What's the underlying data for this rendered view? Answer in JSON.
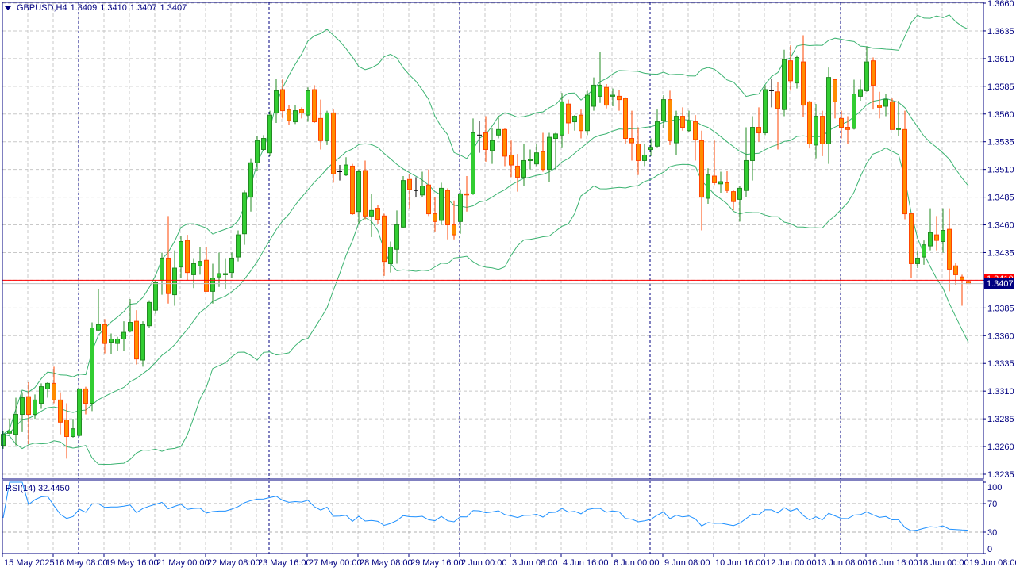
{
  "header": {
    "symbol": "GBPUSD,H4",
    "open": "1.3409",
    "high": "1.3410",
    "low": "1.3407",
    "close": "1.3407",
    "dropdown_icon": "triangle-down-icon"
  },
  "rsi_panel": {
    "label": "RSI(14)",
    "value": "32.4450",
    "levels_labels": [
      "100",
      "70",
      "30",
      "0"
    ]
  },
  "price_labels": {
    "bid": "1.3407",
    "ask": "1.3410"
  },
  "colors": {
    "frame": "#000080",
    "bull_fill": "#32cd32",
    "bull_border": "#228b22",
    "bear_fill": "#ff8c00",
    "bear_border": "#ff4500",
    "doji": "#000000",
    "bands": "#3cb371",
    "rsi": "#1e90ff",
    "ask_line": "#ff0000",
    "bid_line": "#c0c0c0",
    "grid": "#c8c8c8"
  },
  "chart_data": {
    "type": "candlestick",
    "title": "GBPUSD,H4",
    "y_axis": {
      "min": 1.3235,
      "max": 1.366,
      "step": 0.0025,
      "tick_labels": [
        "1.3660",
        "1.3635",
        "1.3610",
        "1.3585",
        "1.3560",
        "1.3535",
        "1.3510",
        "1.3485",
        "1.3460",
        "1.3435",
        "1.3410",
        "1.3385",
        "1.3360",
        "1.3335",
        "1.3310",
        "1.3285",
        "1.3260",
        "1.3235"
      ]
    },
    "x_axis": {
      "tick_every_candles": 8,
      "tick_labels": [
        "15 May 2025",
        "16 May 08:00",
        "19 May 16:00",
        "21 May 00:00",
        "22 May 08:00",
        "23 May 16:00",
        "27 May 00:00",
        "28 May 08:00",
        "29 May 16:00",
        "2 Jun 00:00",
        "3 Jun 08:00",
        "4 Jun 16:00",
        "6 Jun 00:00",
        "9 Jun 08:00",
        "10 Jun 16:00",
        "12 Jun 00:00",
        "13 Jun 08:00",
        "16 Jun 16:00",
        "18 Jun 00:00",
        "19 Jun 08:00"
      ]
    },
    "period_separators_at_candle": [
      12,
      42,
      72,
      102,
      132
    ],
    "bid": 1.3407,
    "ask": 1.341,
    "grid": true,
    "indicators": [
      {
        "name": "Bollinger Bands",
        "period": 20,
        "deviation": 2
      },
      {
        "name": "RSI",
        "period": 14,
        "levels": [
          30,
          70
        ],
        "range": [
          0,
          100
        ]
      }
    ],
    "ohlc": [
      [
        1.3261,
        1.3274,
        1.3258,
        1.3271
      ],
      [
        1.3272,
        1.3285,
        1.3271,
        1.3274
      ],
      [
        1.3271,
        1.3304,
        1.3261,
        1.3289
      ],
      [
        1.3289,
        1.3309,
        1.3273,
        1.3304
      ],
      [
        1.3305,
        1.3318,
        1.3262,
        1.3289
      ],
      [
        1.3289,
        1.3307,
        1.3285,
        1.3302
      ],
      [
        1.3299,
        1.3317,
        1.3294,
        1.3314
      ],
      [
        1.3312,
        1.3318,
        1.3304,
        1.3317
      ],
      [
        1.3317,
        1.3332,
        1.3299,
        1.3302
      ],
      [
        1.3302,
        1.3309,
        1.3271,
        1.3282
      ],
      [
        1.3284,
        1.3299,
        1.3249,
        1.3269
      ],
      [
        1.3269,
        1.3285,
        1.3268,
        1.3276
      ],
      [
        1.327,
        1.3312,
        1.3269,
        1.3312
      ],
      [
        1.3312,
        1.3314,
        1.3289,
        1.3299
      ],
      [
        1.3299,
        1.3372,
        1.3292,
        1.3367
      ],
      [
        1.3365,
        1.3402,
        1.3364,
        1.337
      ],
      [
        1.337,
        1.3375,
        1.3344,
        1.3353
      ],
      [
        1.3354,
        1.3362,
        1.3343,
        1.3357
      ],
      [
        1.3353,
        1.3359,
        1.3346,
        1.3357
      ],
      [
        1.3357,
        1.3373,
        1.3346,
        1.3363
      ],
      [
        1.3364,
        1.3393,
        1.3363,
        1.3372
      ],
      [
        1.3373,
        1.3383,
        1.3334,
        1.3339
      ],
      [
        1.3338,
        1.3373,
        1.3332,
        1.337
      ],
      [
        1.3369,
        1.3392,
        1.3367,
        1.339
      ],
      [
        1.3383,
        1.341,
        1.338,
        1.3408
      ],
      [
        1.341,
        1.3435,
        1.3397,
        1.343
      ],
      [
        1.343,
        1.3468,
        1.3389,
        1.3398
      ],
      [
        1.3397,
        1.3437,
        1.3387,
        1.3421
      ],
      [
        1.3422,
        1.345,
        1.3412,
        1.3445
      ],
      [
        1.3446,
        1.3451,
        1.341,
        1.3417
      ],
      [
        1.3415,
        1.343,
        1.3403,
        1.3425
      ],
      [
        1.3423,
        1.344,
        1.3415,
        1.3427
      ],
      [
        1.3428,
        1.344,
        1.34,
        1.34
      ],
      [
        1.34,
        1.3425,
        1.3389,
        1.3412
      ],
      [
        1.3413,
        1.3435,
        1.3404,
        1.3416
      ],
      [
        1.3415,
        1.343,
        1.3402,
        1.3416
      ],
      [
        1.3417,
        1.3435,
        1.3412,
        1.343
      ],
      [
        1.3431,
        1.3455,
        1.3427,
        1.3451
      ],
      [
        1.3452,
        1.3491,
        1.3442,
        1.3489
      ],
      [
        1.3485,
        1.352,
        1.3472,
        1.3516
      ],
      [
        1.3516,
        1.354,
        1.3509,
        1.3536
      ],
      [
        1.3528,
        1.3541,
        1.3527,
        1.3538
      ],
      [
        1.3525,
        1.3563,
        1.3522,
        1.3559
      ],
      [
        1.3561,
        1.3592,
        1.3552,
        1.3581
      ],
      [
        1.3582,
        1.3592,
        1.3556,
        1.3563
      ],
      [
        1.3564,
        1.3568,
        1.355,
        1.3554
      ],
      [
        1.3553,
        1.3568,
        1.3551,
        1.3563
      ],
      [
        1.3564,
        1.3566,
        1.3556,
        1.3561
      ],
      [
        1.3559,
        1.3584,
        1.3553,
        1.3581
      ],
      [
        1.3582,
        1.3586,
        1.3552,
        1.3553
      ],
      [
        1.3556,
        1.3573,
        1.3528,
        1.3536
      ],
      [
        1.3536,
        1.3563,
        1.3532,
        1.3561
      ],
      [
        1.3561,
        1.3564,
        1.3498,
        1.3506
      ],
      [
        1.3508,
        1.3514,
        1.35,
        1.3508
      ],
      [
        1.3505,
        1.3521,
        1.3504,
        1.3514
      ],
      [
        1.3513,
        1.3515,
        1.3469,
        1.347
      ],
      [
        1.3472,
        1.351,
        1.3461,
        1.3508
      ],
      [
        1.3509,
        1.3518,
        1.3465,
        1.3468
      ],
      [
        1.3468,
        1.3488,
        1.3449,
        1.3473
      ],
      [
        1.3475,
        1.3478,
        1.3461,
        1.3465
      ],
      [
        1.3468,
        1.347,
        1.3414,
        1.3427
      ],
      [
        1.3425,
        1.3445,
        1.3417,
        1.344
      ],
      [
        1.3438,
        1.3473,
        1.3425,
        1.346
      ],
      [
        1.3458,
        1.3504,
        1.3457,
        1.35
      ],
      [
        1.3501,
        1.3506,
        1.3475,
        1.3492
      ],
      [
        1.3491,
        1.3503,
        1.3485,
        1.3491
      ],
      [
        1.3487,
        1.3508,
        1.3485,
        1.3495
      ],
      [
        1.3496,
        1.351,
        1.3468,
        1.347
      ],
      [
        1.347,
        1.3485,
        1.3454,
        1.3463
      ],
      [
        1.3464,
        1.3498,
        1.346,
        1.3493
      ],
      [
        1.3491,
        1.3493,
        1.3447,
        1.346
      ],
      [
        1.346,
        1.3482,
        1.3447,
        1.3451
      ],
      [
        1.3463,
        1.3492,
        1.3452,
        1.3488
      ],
      [
        1.3488,
        1.3504,
        1.3472,
        1.3487
      ],
      [
        1.3488,
        1.3556,
        1.3487,
        1.3543
      ],
      [
        1.3541,
        1.3554,
        1.3525,
        1.3541
      ],
      [
        1.3543,
        1.3558,
        1.3517,
        1.3528
      ],
      [
        1.3527,
        1.3547,
        1.3515,
        1.3536
      ],
      [
        1.3541,
        1.3558,
        1.3538,
        1.3546
      ],
      [
        1.3546,
        1.3547,
        1.3513,
        1.3522
      ],
      [
        1.3523,
        1.3536,
        1.3503,
        1.3514
      ],
      [
        1.3513,
        1.3524,
        1.349,
        1.3503
      ],
      [
        1.3503,
        1.3533,
        1.3495,
        1.3518
      ],
      [
        1.3518,
        1.3528,
        1.351,
        1.3519
      ],
      [
        1.3515,
        1.3533,
        1.3513,
        1.3525
      ],
      [
        1.3526,
        1.3543,
        1.3508,
        1.351
      ],
      [
        1.351,
        1.3543,
        1.3499,
        1.3539
      ],
      [
        1.3538,
        1.3543,
        1.351,
        1.3542
      ],
      [
        1.3541,
        1.3579,
        1.353,
        1.3571
      ],
      [
        1.3569,
        1.3573,
        1.3542,
        1.3552
      ],
      [
        1.3553,
        1.3559,
        1.3545,
        1.3558
      ],
      [
        1.3559,
        1.3564,
        1.3538,
        1.3545
      ],
      [
        1.3545,
        1.3581,
        1.3541,
        1.3577
      ],
      [
        1.3567,
        1.3593,
        1.3563,
        1.3586
      ],
      [
        1.3576,
        1.3616,
        1.357,
        1.3586
      ],
      [
        1.3584,
        1.3587,
        1.3565,
        1.3568
      ],
      [
        1.3576,
        1.3583,
        1.3567,
        1.3577
      ],
      [
        1.3576,
        1.3582,
        1.3563,
        1.3573
      ],
      [
        1.3574,
        1.3575,
        1.3533,
        1.3538
      ],
      [
        1.3538,
        1.3563,
        1.3518,
        1.3534
      ],
      [
        1.3533,
        1.3548,
        1.3505,
        1.3518
      ],
      [
        1.3518,
        1.3533,
        1.3513,
        1.3523
      ],
      [
        1.3528,
        1.3538,
        1.3522,
        1.353
      ],
      [
        1.3531,
        1.3564,
        1.353,
        1.3553
      ],
      [
        1.3554,
        1.3577,
        1.3547,
        1.3573
      ],
      [
        1.3573,
        1.3581,
        1.3532,
        1.3536
      ],
      [
        1.3534,
        1.3563,
        1.3523,
        1.3558
      ],
      [
        1.3558,
        1.3566,
        1.3545,
        1.3548
      ],
      [
        1.3545,
        1.3563,
        1.3544,
        1.3554
      ],
      [
        1.3553,
        1.3559,
        1.3518,
        1.3537
      ],
      [
        1.3536,
        1.3545,
        1.3455,
        1.3485
      ],
      [
        1.3484,
        1.3511,
        1.3479,
        1.3505
      ],
      [
        1.3504,
        1.3536,
        1.3496,
        1.3498
      ],
      [
        1.3497,
        1.3508,
        1.3489,
        1.3499
      ],
      [
        1.3498,
        1.3509,
        1.3489,
        1.3491
      ],
      [
        1.349,
        1.3491,
        1.3473,
        1.3481
      ],
      [
        1.3483,
        1.3495,
        1.3463,
        1.3493
      ],
      [
        1.3491,
        1.3548,
        1.3485,
        1.3518
      ],
      [
        1.3518,
        1.3558,
        1.35,
        1.3548
      ],
      [
        1.3548,
        1.3566,
        1.3535,
        1.3543
      ],
      [
        1.3543,
        1.3586,
        1.3541,
        1.3582
      ],
      [
        1.3581,
        1.3592,
        1.3566,
        1.3581
      ],
      [
        1.358,
        1.3589,
        1.3528,
        1.3565
      ],
      [
        1.3564,
        1.3618,
        1.3558,
        1.3609
      ],
      [
        1.3608,
        1.3622,
        1.3581,
        1.359
      ],
      [
        1.3588,
        1.3613,
        1.3583,
        1.3611
      ],
      [
        1.3607,
        1.3631,
        1.3557,
        1.3568
      ],
      [
        1.3571,
        1.3572,
        1.3529,
        1.3533
      ],
      [
        1.3532,
        1.3569,
        1.352,
        1.3558
      ],
      [
        1.3558,
        1.3563,
        1.3522,
        1.3533
      ],
      [
        1.3533,
        1.3602,
        1.3515,
        1.3593
      ],
      [
        1.3591,
        1.3592,
        1.3556,
        1.3571
      ],
      [
        1.3556,
        1.3563,
        1.3538,
        1.3548
      ],
      [
        1.3548,
        1.3558,
        1.3533,
        1.3546
      ],
      [
        1.3547,
        1.3591,
        1.3546,
        1.3578
      ],
      [
        1.3576,
        1.3591,
        1.3572,
        1.3582
      ],
      [
        1.3581,
        1.3621,
        1.358,
        1.3607
      ],
      [
        1.3608,
        1.3611,
        1.3564,
        1.3586
      ],
      [
        1.3568,
        1.358,
        1.3556,
        1.3566
      ],
      [
        1.3567,
        1.3578,
        1.3558,
        1.3573
      ],
      [
        1.3571,
        1.3574,
        1.3546,
        1.3546
      ],
      [
        1.3546,
        1.3572,
        1.354,
        1.3547
      ],
      [
        1.3546,
        1.3563,
        1.3465,
        1.347
      ],
      [
        1.347,
        1.3471,
        1.3412,
        1.3425
      ],
      [
        1.3425,
        1.3437,
        1.3421,
        1.343
      ],
      [
        1.3431,
        1.3446,
        1.3424,
        1.3442
      ],
      [
        1.3441,
        1.3475,
        1.3437,
        1.3453
      ],
      [
        1.3451,
        1.3468,
        1.3437,
        1.3446
      ],
      [
        1.3445,
        1.3475,
        1.3435,
        1.3455
      ],
      [
        1.3456,
        1.3475,
        1.34,
        1.342
      ],
      [
        1.3423,
        1.3426,
        1.3406,
        1.3415
      ],
      [
        1.3413,
        1.3415,
        1.3387,
        1.341
      ],
      [
        1.3409,
        1.341,
        1.3407,
        1.3407
      ]
    ]
  }
}
